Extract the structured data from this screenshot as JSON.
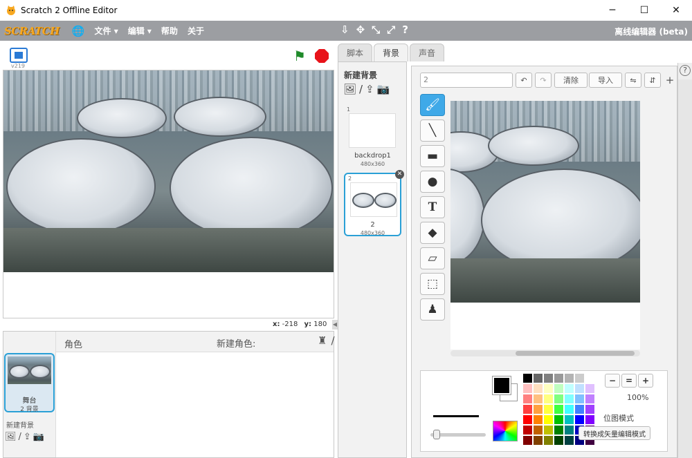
{
  "window": {
    "title": "Scratch 2 Offline Editor",
    "controls": [
      "─",
      "☐",
      "✕"
    ]
  },
  "menubar": {
    "logo": "SCRATCH",
    "globe_icon": "globe-icon",
    "file": "文件 ▾",
    "edit": "编辑 ▾",
    "help": "帮助",
    "about": "关于",
    "editor_label": "离线编辑器 (beta)",
    "tools": [
      "⇩",
      "✥",
      "⤡",
      "⤢",
      "?"
    ]
  },
  "stage": {
    "version": "v219",
    "x_label": "x:",
    "x_value": "-218",
    "y_label": "y:",
    "y_value": "180"
  },
  "sprites": {
    "header_label": "角色",
    "new_sprite_label": "新建角色:",
    "stage_name": "舞台",
    "stage_backdrops": "2 背景",
    "new_backdrop_label": "新建背景"
  },
  "tabs": {
    "scripts": "脚本",
    "backdrops": "背景",
    "sounds": "声音"
  },
  "backdrops": {
    "new_label": "新建背景",
    "items": [
      {
        "num": "1",
        "name": "backdrop1",
        "size": "480x360"
      },
      {
        "num": "2",
        "name": "2",
        "size": "480x360"
      }
    ]
  },
  "editor": {
    "name_value": "2",
    "clear": "清除",
    "import": "导入",
    "zoom": "100%",
    "mode_label": "位图模式",
    "convert": "转换成矢量编辑模式"
  },
  "colors": {
    "accent": "#2aa0d6",
    "menubar": "#9c9ea2",
    "palette": [
      "#000000",
      "#666666",
      "#808080",
      "#999999",
      "#b3b3b3",
      "#cccccc",
      "#ffffff",
      "#ffc0c0",
      "#ffe0c0",
      "#ffffc0",
      "#c0ffc0",
      "#c0ffff",
      "#c0e0ff",
      "#e0c0ff",
      "#ff8080",
      "#ffc080",
      "#ffff80",
      "#80ff80",
      "#80ffff",
      "#80c0ff",
      "#c080ff",
      "#ff4040",
      "#ffa040",
      "#ffff40",
      "#40ff40",
      "#40ffff",
      "#4080ff",
      "#a040ff",
      "#ff0000",
      "#ff8000",
      "#ffff00",
      "#00c000",
      "#00c0c0",
      "#0000ff",
      "#8000ff",
      "#c00000",
      "#c06000",
      "#c0c000",
      "#008000",
      "#008080",
      "#0000c0",
      "#600080",
      "#800000",
      "#804000",
      "#808000",
      "#004000",
      "#004040",
      "#000080",
      "#400040"
    ]
  }
}
